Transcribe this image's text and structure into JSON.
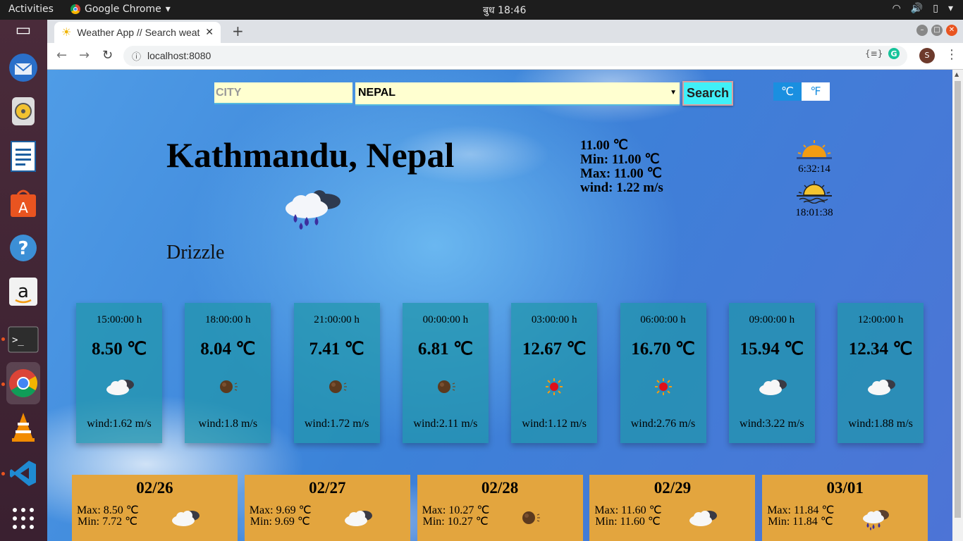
{
  "os": {
    "activities": "Activities",
    "app_name": "Google Chrome",
    "clock": "बुध 18:46"
  },
  "browser": {
    "tab_title": "Weather App // Search weather",
    "url": "localhost:8080",
    "profile_initial": "S"
  },
  "form": {
    "city_placeholder": "CITY",
    "country_value": "NEPAL",
    "search_label": "Search",
    "unit_c": "℃",
    "unit_f": "℉"
  },
  "current": {
    "city": "Kathmandu, Nepal",
    "description": "Drizzle",
    "temp": "11.00 ℃",
    "min": "Min: 11.00 ℃",
    "max": "Max: 11.00 ℃",
    "wind": "wind: 1.22 m/s",
    "sunrise": "6:32:14",
    "sunset": "18:01:38",
    "icon": "drizzle-cloud-icon"
  },
  "hourly": [
    {
      "time": "15:00:00 h",
      "temp": "8.50 ℃",
      "wind": "wind:1.62 m/s",
      "icon": "cloudy-icon"
    },
    {
      "time": "18:00:00 h",
      "temp": "8.04 ℃",
      "wind": "wind:1.8 m/s",
      "icon": "night-icon"
    },
    {
      "time": "21:00:00 h",
      "temp": "7.41 ℃",
      "wind": "wind:1.72 m/s",
      "icon": "night-icon"
    },
    {
      "time": "00:00:00 h",
      "temp": "6.81 ℃",
      "wind": "wind:2.11 m/s",
      "icon": "night-icon"
    },
    {
      "time": "03:00:00 h",
      "temp": "12.67 ℃",
      "wind": "wind:1.12 m/s",
      "icon": "sun-icon"
    },
    {
      "time": "06:00:00 h",
      "temp": "16.70 ℃",
      "wind": "wind:2.76 m/s",
      "icon": "sun-icon"
    },
    {
      "time": "09:00:00 h",
      "temp": "15.94 ℃",
      "wind": "wind:3.22 m/s",
      "icon": "cloudy-icon"
    },
    {
      "time": "12:00:00 h",
      "temp": "12.34 ℃",
      "wind": "wind:1.88 m/s",
      "icon": "cloudy-icon"
    }
  ],
  "daily": [
    {
      "date": "02/26",
      "max": "Max: 8.50 ℃",
      "min": "Min: 7.72 ℃",
      "icon": "cloudy-icon"
    },
    {
      "date": "02/27",
      "max": "Max: 9.69 ℃",
      "min": "Min: 9.69 ℃",
      "icon": "cloudy-icon"
    },
    {
      "date": "02/28",
      "max": "Max: 10.27 ℃",
      "min": "Min: 10.27 ℃",
      "icon": "night-icon"
    },
    {
      "date": "02/29",
      "max": "Max: 11.60 ℃",
      "min": "Min: 11.60 ℃",
      "icon": "cloudy-icon"
    },
    {
      "date": "03/01",
      "max": "Max: 11.84 ℃",
      "min": "Min: 11.84 ℃",
      "icon": "rain-icon"
    }
  ],
  "colors": {
    "hour_card": "#2096aa",
    "day_card": "#e3a53e",
    "search_button": "#40f0f8",
    "input_bg": "#ffffd0",
    "unit_active": "#1a8fe0"
  }
}
